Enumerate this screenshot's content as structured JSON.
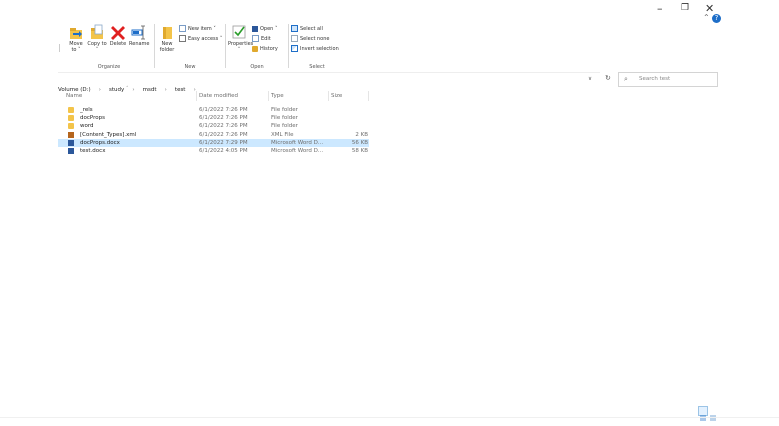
{
  "window": {
    "minimize": "–",
    "maximize": "❐",
    "close": "✕",
    "help": "?",
    "collapse_ribbon": "⌃"
  },
  "ribbon": {
    "organize": {
      "label": "Organize",
      "move_to": "Move to ˅",
      "copy_to": "Copy to ˅",
      "delete": "Delete",
      "rename": "Rename"
    },
    "new": {
      "label": "New",
      "new_folder": "New folder",
      "new_item": "New item ˅",
      "easy_access": "Easy access ˅"
    },
    "open": {
      "label": "Open",
      "properties": "Properties ˅",
      "open": "Open ˅",
      "edit": "Edit",
      "history": "History"
    },
    "select": {
      "label": "Select",
      "select_all": "Select all",
      "select_none": "Select none",
      "invert_selection": "Invert selection"
    }
  },
  "address": {
    "segments": [
      "Volume (D:)",
      "study",
      "msdt",
      "test"
    ],
    "separator": "›",
    "dropdown": "∨",
    "refresh": "↻"
  },
  "search": {
    "icon": "⌕",
    "placeholder": "Search test"
  },
  "columns": {
    "name": "Name",
    "date": "Date modified",
    "type": "Type",
    "size": "Size",
    "sort_indicator": "˄"
  },
  "files": [
    {
      "name": "_rels",
      "date": "6/1/2022 7:26 PM",
      "type": "File folder",
      "size": "",
      "icon": "folder-icon"
    },
    {
      "name": "docProps",
      "date": "6/1/2022 7:26 PM",
      "type": "File folder",
      "size": "",
      "icon": "folder-icon"
    },
    {
      "name": "word",
      "date": "6/1/2022 7:26 PM",
      "type": "File folder",
      "size": "",
      "icon": "folder-icon"
    },
    {
      "name": "[Content_Types].xml",
      "date": "6/1/2022 7:26 PM",
      "type": "XML File",
      "size": "2 KB",
      "icon": "xml-file-icon"
    },
    {
      "name": "docProps.docx",
      "date": "6/1/2022 7:29 PM",
      "type": "Microsoft Word D...",
      "size": "56 KB",
      "icon": "word-doc-icon",
      "selected": true
    },
    {
      "name": "test.docx",
      "date": "6/1/2022 4:05 PM",
      "type": "Microsoft Word D...",
      "size": "58 KB",
      "icon": "word-doc-icon"
    }
  ],
  "colors": {
    "selection": "#cce8ff",
    "accent": "#1e6ec8",
    "folder": "#f3c44a",
    "word": "#2b579a"
  }
}
